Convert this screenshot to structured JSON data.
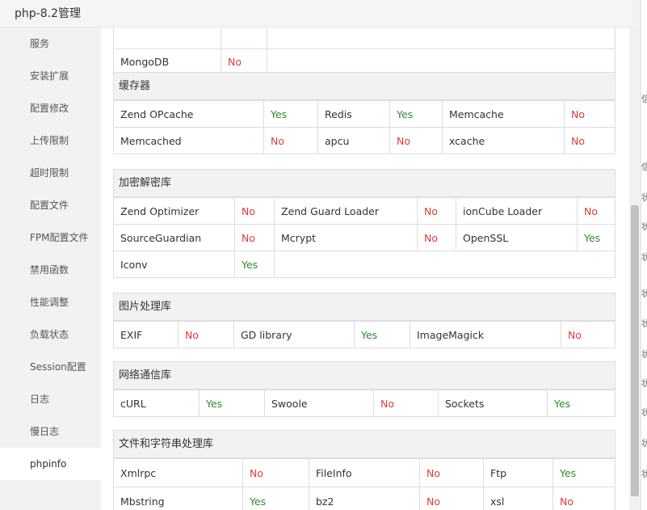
{
  "window": {
    "title": "php-8.2管理"
  },
  "sidebar": {
    "items": [
      {
        "label": "服务",
        "active": false
      },
      {
        "label": "安装扩展",
        "active": false
      },
      {
        "label": "配置修改",
        "active": false
      },
      {
        "label": "上传限制",
        "active": false
      },
      {
        "label": "超时限制",
        "active": false
      },
      {
        "label": "配置文件",
        "active": false
      },
      {
        "label": "FPM配置文件",
        "active": false
      },
      {
        "label": "禁用函数",
        "active": false
      },
      {
        "label": "性能调整",
        "active": false
      },
      {
        "label": "负载状态",
        "active": false
      },
      {
        "label": "Session配置",
        "active": false
      },
      {
        "label": "日志",
        "active": false
      },
      {
        "label": "慢日志",
        "active": false
      },
      {
        "label": "phpinfo",
        "active": true
      }
    ]
  },
  "groups": [
    {
      "title": "",
      "rows": [
        [
          {
            "name": "MongoDB",
            "status": "No"
          }
        ]
      ]
    },
    {
      "title": "缓存器",
      "rows": [
        [
          {
            "name": "Zend OPcache",
            "status": "Yes"
          },
          {
            "name": "Redis",
            "status": "Yes"
          },
          {
            "name": "Memcache",
            "status": "No"
          }
        ],
        [
          {
            "name": "Memcached",
            "status": "No"
          },
          {
            "name": "apcu",
            "status": "No"
          },
          {
            "name": "xcache",
            "status": "No"
          }
        ]
      ]
    },
    {
      "title": "加密解密库",
      "rows": [
        [
          {
            "name": "Zend Optimizer",
            "status": "No"
          },
          {
            "name": "Zend Guard Loader",
            "status": "No"
          },
          {
            "name": "ionCube Loader",
            "status": "No"
          }
        ],
        [
          {
            "name": "SourceGuardian",
            "status": "No"
          },
          {
            "name": "Mcrypt",
            "status": "No"
          },
          {
            "name": "OpenSSL",
            "status": "Yes"
          }
        ],
        [
          {
            "name": "Iconv",
            "status": "Yes"
          }
        ]
      ]
    },
    {
      "title": "图片处理库",
      "rows": [
        [
          {
            "name": "EXIF",
            "status": "No"
          },
          {
            "name": "GD library",
            "status": "Yes"
          },
          {
            "name": "ImageMagick",
            "status": "No"
          }
        ]
      ]
    },
    {
      "title": "网络通信库",
      "rows": [
        [
          {
            "name": "cURL",
            "status": "Yes"
          },
          {
            "name": "Swoole",
            "status": "No"
          },
          {
            "name": "Sockets",
            "status": "Yes"
          }
        ]
      ]
    },
    {
      "title": "文件和字符串处理库",
      "rows": [
        [
          {
            "name": "Xmlrpc",
            "status": "No"
          },
          {
            "name": "FileInfo",
            "status": "No"
          },
          {
            "name": "Ftp",
            "status": "Yes"
          }
        ],
        [
          {
            "name": "Mbstring",
            "status": "Yes"
          },
          {
            "name": "bz2",
            "status": "No"
          },
          {
            "name": "xsl",
            "status": "No"
          }
        ]
      ]
    }
  ],
  "edge_fragments": [
    "信",
    "信",
    "状",
    "状",
    "状",
    "状",
    "状",
    "状",
    "状",
    "状",
    "状",
    "状"
  ]
}
